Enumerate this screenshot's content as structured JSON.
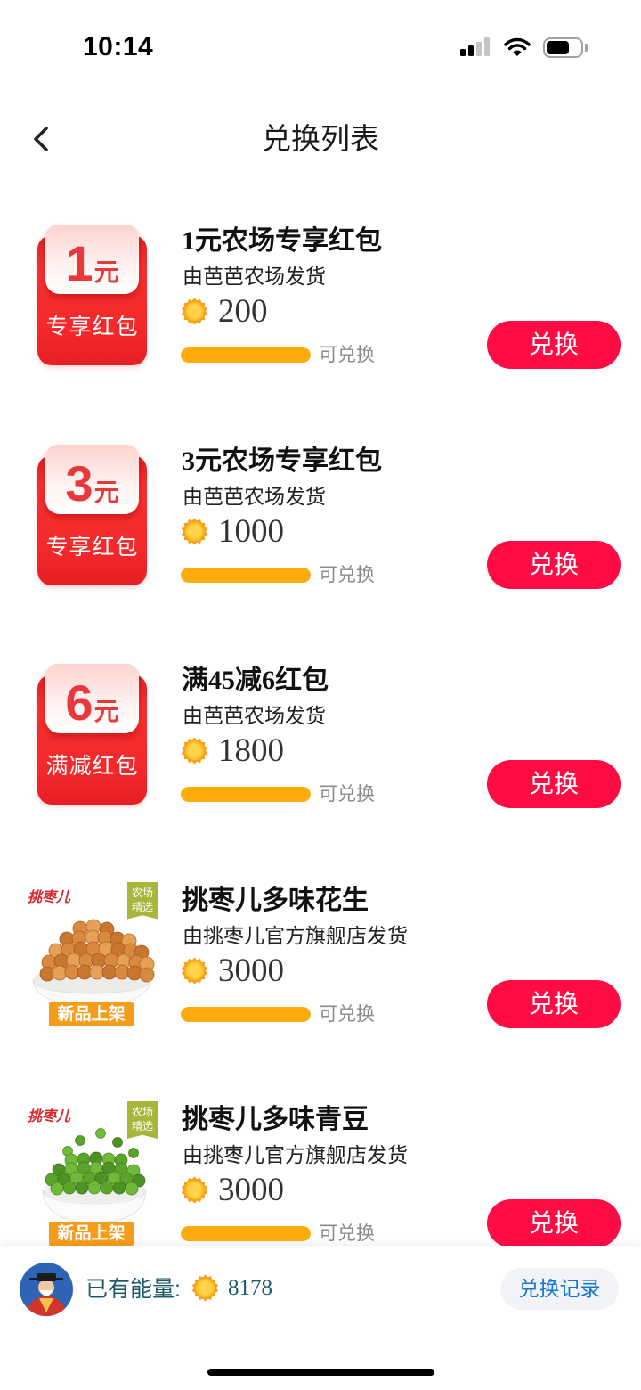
{
  "status_bar": {
    "time": "10:14",
    "icons": [
      "cellular-signal-icon",
      "wifi-icon",
      "battery-icon"
    ]
  },
  "nav": {
    "back_icon": "chevron-left-icon",
    "title": "兑换列表"
  },
  "theme": {
    "accent": "#ff0c45",
    "progress": "#ffab0c",
    "energy_text": "#1f5c69",
    "link": "#1677d2"
  },
  "items": [
    {
      "thumb_icon": "red-packet-icon",
      "amount": "1",
      "unit": "元",
      "label": "专享红包",
      "title": "1元农场专享红包",
      "seller": "由芭芭农场发货",
      "cost_icon": "energy-coin-icon",
      "cost": "200",
      "progress": 1,
      "status": "可兑换",
      "button": "兑换"
    },
    {
      "thumb_icon": "red-packet-icon",
      "amount": "3",
      "unit": "元",
      "label": "专享红包",
      "title": "3元农场专享红包",
      "seller": "由芭芭农场发货",
      "cost_icon": "energy-coin-icon",
      "cost": "1000",
      "progress": 1,
      "status": "可兑换",
      "button": "兑换"
    },
    {
      "thumb_icon": "red-packet-icon",
      "amount": "6",
      "unit": "元",
      "label": "满减红包",
      "title": "满45减6红包",
      "seller": "由芭芭农场发货",
      "cost_icon": "energy-coin-icon",
      "cost": "1800",
      "progress": 1,
      "status": "可兑换",
      "button": "兑换"
    },
    {
      "thumb_icon": "peanuts-product-image",
      "brand": "挑枣儿",
      "tag": [
        "农场",
        "精选"
      ],
      "badge": "新品上架",
      "title": "挑枣儿多味花生",
      "seller": "由挑枣儿官方旗舰店发货",
      "cost_icon": "energy-coin-icon",
      "cost": "3000",
      "progress": 1,
      "status": "可兑换",
      "button": "兑换"
    },
    {
      "thumb_icon": "green-peas-product-image",
      "brand": "挑枣儿",
      "tag": [
        "农场",
        "精选"
      ],
      "badge": "新品上架",
      "title": "挑枣儿多味青豆",
      "seller": "由挑枣儿官方旗舰店发货",
      "cost_icon": "energy-coin-icon",
      "cost": "3000",
      "progress": 1,
      "status": "可兑换",
      "button": "兑换"
    }
  ],
  "footer": {
    "avatar_icon": "user-avatar",
    "energy_label": "已有能量:",
    "energy_icon": "energy-coin-icon",
    "energy_value": "8178",
    "records_button": "兑换记录"
  }
}
